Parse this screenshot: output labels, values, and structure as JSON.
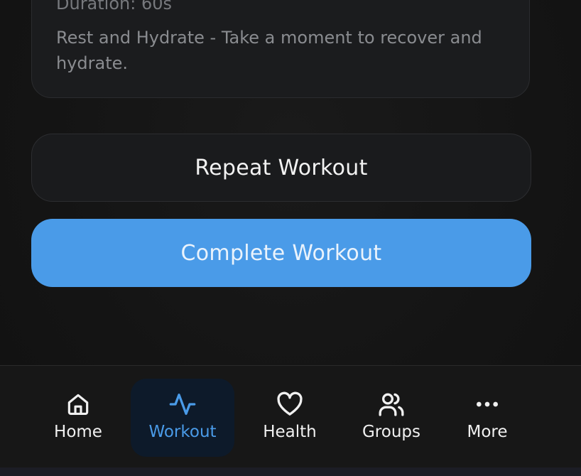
{
  "step": {
    "duration": "Duration: 60s",
    "description": "Rest and Hydrate - Take a moment to recover and hydrate."
  },
  "actions": {
    "repeat_label": "Repeat Workout",
    "complete_label": "Complete Workout"
  },
  "nav": {
    "active": "Workout",
    "accent_color": "#4a9be8",
    "items": [
      {
        "label": "Home",
        "icon": "home-icon"
      },
      {
        "label": "Workout",
        "icon": "activity-icon"
      },
      {
        "label": "Health",
        "icon": "heart-icon"
      },
      {
        "label": "Groups",
        "icon": "users-icon"
      },
      {
        "label": "More",
        "icon": "more-icon"
      }
    ]
  }
}
